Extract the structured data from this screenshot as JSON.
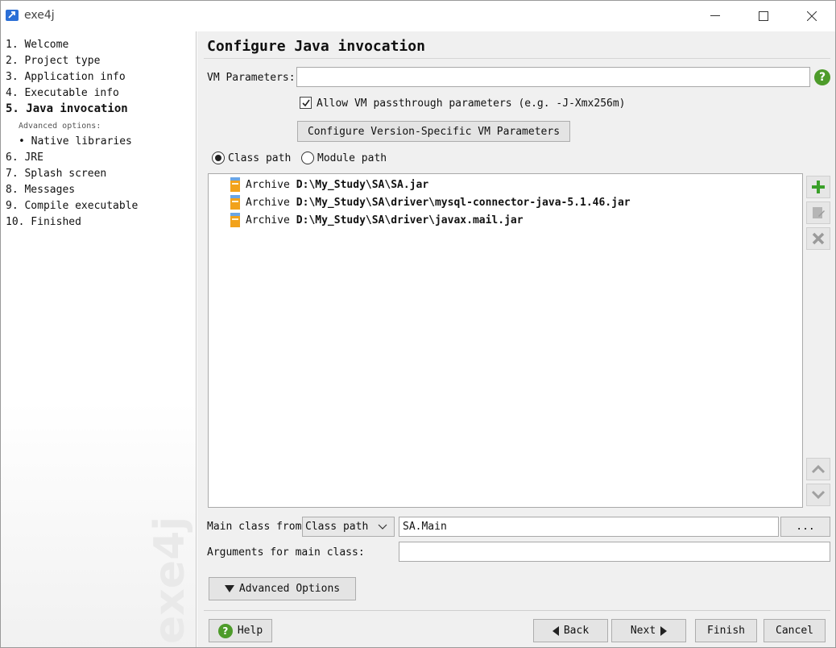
{
  "window": {
    "title": "exe4j"
  },
  "sidebar": {
    "steps": [
      {
        "label": "1. Welcome"
      },
      {
        "label": "2. Project type"
      },
      {
        "label": "3. Application info"
      },
      {
        "label": "4. Executable info"
      },
      {
        "label": "5. Java invocation",
        "active": true
      },
      {
        "label": "6. JRE"
      },
      {
        "label": "7. Splash screen"
      },
      {
        "label": "8. Messages"
      },
      {
        "label": "9. Compile executable"
      },
      {
        "label": "10. Finished"
      }
    ],
    "advanced_label": "Advanced options:",
    "advanced_items": [
      "• Native libraries"
    ],
    "watermark": "exe4j"
  },
  "main": {
    "title": "Configure Java invocation",
    "vm_params_label": "VM Parameters:",
    "vm_params_value": "",
    "passthrough_checkbox": {
      "label": "Allow VM passthrough parameters (e.g. -J-Xmx256m)",
      "checked": true
    },
    "version_specific_button": "Configure Version-Specific VM Parameters",
    "path_mode": {
      "class_path": "Class path",
      "module_path": "Module path",
      "selected": "class_path"
    },
    "archives": [
      {
        "kind": "Archive",
        "path": "D:\\My_Study\\SA\\SA.jar"
      },
      {
        "kind": "Archive",
        "path": "D:\\My_Study\\SA\\driver\\mysql-connector-java-5.1.46.jar"
      },
      {
        "kind": "Archive",
        "path": "D:\\My_Study\\SA\\driver\\javax.mail.jar"
      }
    ],
    "main_class_from_label": "Main class from",
    "main_class_source": "Class path",
    "main_class_value": "SA.Main",
    "browse_button": "...",
    "arguments_label": "Arguments for main class:",
    "arguments_value": "",
    "advanced_options_button": "Advanced Options"
  },
  "footer": {
    "help": "Help",
    "back": "Back",
    "next": "Next",
    "finish": "Finish",
    "cancel": "Cancel"
  },
  "colors": {
    "accent_green": "#4d9b2a",
    "jar_orange": "#f2a21b",
    "panel_bg": "#f0f0f0"
  }
}
